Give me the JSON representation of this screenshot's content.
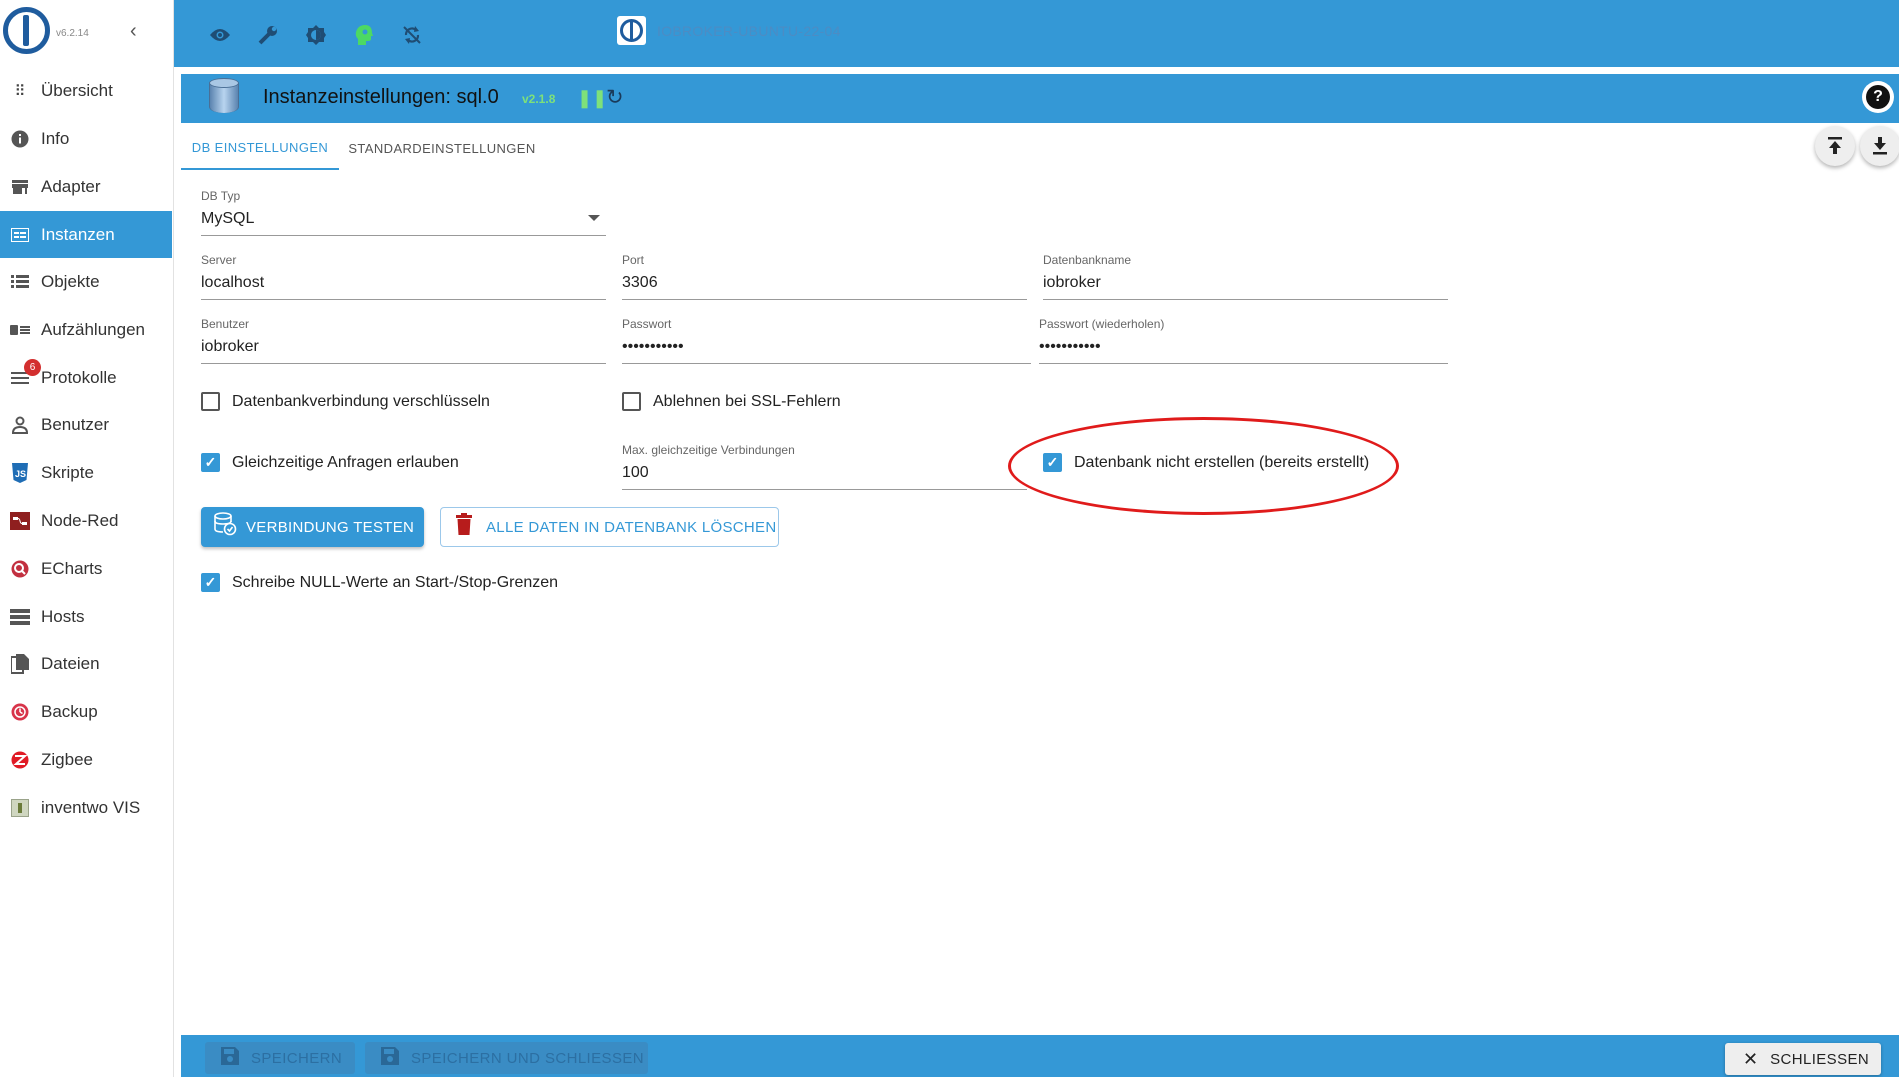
{
  "app": {
    "version": "v6.2.14",
    "host": "IOBROKER-UBUNTU-22-04"
  },
  "sidebar": {
    "items": [
      {
        "label": "Übersicht",
        "icon": "grid-icon"
      },
      {
        "label": "Info",
        "icon": "info-icon"
      },
      {
        "label": "Adapter",
        "icon": "store-icon"
      },
      {
        "label": "Instanzen",
        "icon": "instances-icon",
        "active": true
      },
      {
        "label": "Objekte",
        "icon": "list-icon"
      },
      {
        "label": "Aufzählungen",
        "icon": "enum-icon"
      },
      {
        "label": "Protokolle",
        "icon": "log-icon",
        "badge": "6"
      },
      {
        "label": "Benutzer",
        "icon": "user-icon"
      },
      {
        "label": "Skripte",
        "icon": "js-icon"
      },
      {
        "label": "Node-Red",
        "icon": "nodered-icon"
      },
      {
        "label": "ECharts",
        "icon": "echarts-icon"
      },
      {
        "label": "Hosts",
        "icon": "hosts-icon"
      },
      {
        "label": "Dateien",
        "icon": "files-icon"
      },
      {
        "label": "Backup",
        "icon": "backup-icon"
      },
      {
        "label": "Zigbee",
        "icon": "zigbee-icon"
      },
      {
        "label": "inventwo VIS",
        "icon": "vis-icon"
      }
    ]
  },
  "instance": {
    "title": "Instanzeinstellungen: sql.0",
    "version": "v2.1.8"
  },
  "tabs": [
    {
      "label": "DB EINSTELLUNGEN",
      "active": true
    },
    {
      "label": "STANDARDEINSTELLUNGEN",
      "active": false
    }
  ],
  "form": {
    "db_type": {
      "label": "DB Typ",
      "value": "MySQL"
    },
    "server": {
      "label": "Server",
      "value": "localhost"
    },
    "port": {
      "label": "Port",
      "value": "3306"
    },
    "dbname": {
      "label": "Datenbankname",
      "value": "iobroker"
    },
    "user": {
      "label": "Benutzer",
      "value": "iobroker"
    },
    "password": {
      "label": "Passwort",
      "value": "•••••••••••"
    },
    "password2": {
      "label": "Passwort (wiederholen)",
      "value": "•••••••••••"
    },
    "encrypt": {
      "label": "Datenbankverbindung verschlüsseln",
      "checked": false
    },
    "ssl_reject": {
      "label": "Ablehnen bei SSL-Fehlern",
      "checked": false
    },
    "parallel": {
      "label": "Gleichzeitige Anfragen erlauben",
      "checked": true
    },
    "max_conn": {
      "label": "Max. gleichzeitige Verbindungen",
      "value": "100"
    },
    "no_create": {
      "label": "Datenbank nicht erstellen (bereits erstellt)",
      "checked": true
    },
    "null_values": {
      "label": "Schreibe NULL-Werte an Start-/Stop-Grenzen",
      "checked": true
    }
  },
  "buttons": {
    "test": "VERBINDUNG TESTEN",
    "delete": "ALLE DATEN IN DATENBANK LÖSCHEN",
    "save": "SPEICHERN",
    "save_close": "SPEICHERN UND SCHLIESSEN",
    "close": "SCHLIESSEN"
  },
  "colors": {
    "primary": "#3498d6",
    "annotation": "#e01b1b",
    "version_green": "#7ee17a"
  }
}
